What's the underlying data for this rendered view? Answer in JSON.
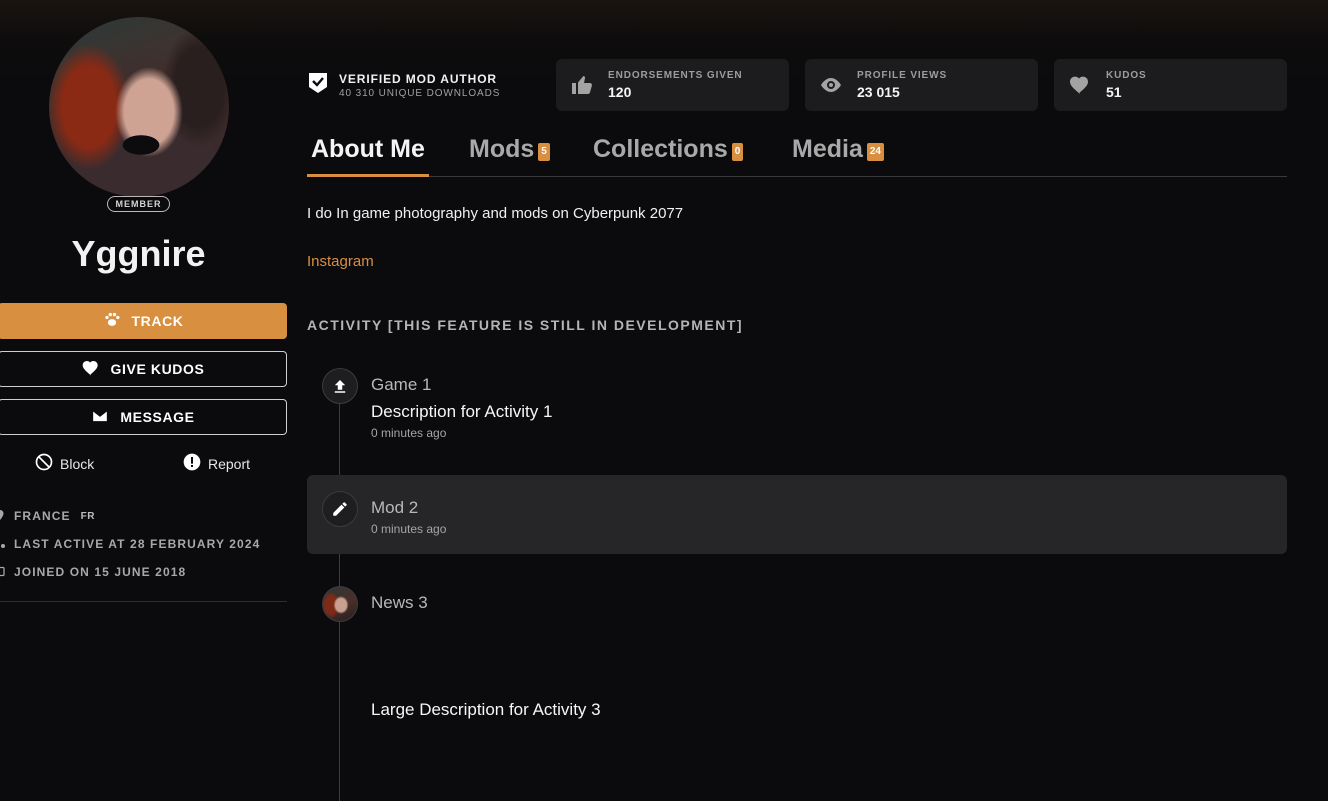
{
  "profile": {
    "role_badge": "MEMBER",
    "username": "Yggnire"
  },
  "actions": {
    "track": "TRACK",
    "give_kudos": "GIVE KUDOS",
    "message": "MESSAGE",
    "block": "Block",
    "report": "Report"
  },
  "meta": {
    "location": "FRANCE",
    "country_code": "FR",
    "last_active": "LAST ACTIVE AT 28 FEBRUARY 2024",
    "joined": "JOINED ON 15 JUNE 2018"
  },
  "verified": {
    "title": "VERIFIED MOD AUTHOR",
    "subtitle": "40 310 UNIQUE DOWNLOADS"
  },
  "stats": [
    {
      "label": "ENDORSEMENTS GIVEN",
      "value": "120",
      "icon": "thumbs-up-icon"
    },
    {
      "label": "PROFILE VIEWS",
      "value": "23 015",
      "icon": "eye-icon"
    },
    {
      "label": "KUDOS",
      "value": "51",
      "icon": "heart-icon"
    }
  ],
  "tabs": [
    {
      "label": "About Me",
      "count": ""
    },
    {
      "label": "Mods",
      "count": "5"
    },
    {
      "label": "Collections",
      "count": "0"
    },
    {
      "label": "Media",
      "count": "24"
    }
  ],
  "about": {
    "bio": "I do In game photography and mods on Cyberpunk 2077",
    "link": "Instagram"
  },
  "activity": {
    "heading": "ACTIVITY [THIS FEATURE IS STILL IN DEVELOPMENT]",
    "items": [
      {
        "title": "Game 1",
        "description": "Description for Activity 1",
        "time": "0 minutes ago",
        "icon": "upload-icon"
      },
      {
        "title": "Mod 2",
        "description": "",
        "time": "0 minutes ago",
        "icon": "pencil-icon"
      },
      {
        "title": "News 3",
        "description": "Large Description for Activity 3",
        "time": "",
        "icon": "avatar"
      }
    ]
  },
  "colors": {
    "accent": "#d98f40",
    "background": "#0b0b0d",
    "card": "#1c1c1f"
  }
}
